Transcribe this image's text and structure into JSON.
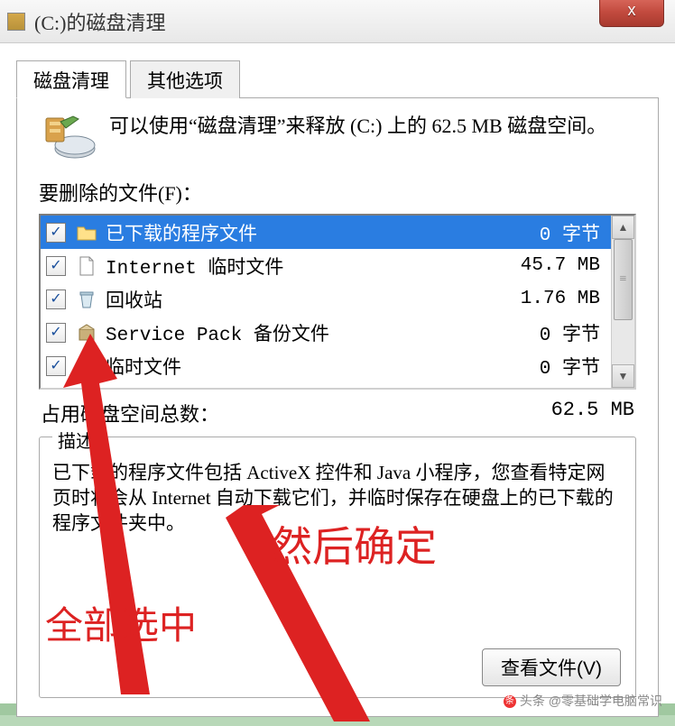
{
  "window": {
    "title": "(C:)的磁盘清理",
    "close_glyph": "x"
  },
  "tabs": {
    "cleanup": "磁盘清理",
    "more_options": "其他选项"
  },
  "intro": "可以使用“磁盘清理”来释放  (C:) 上的 62.5 MB 磁盘空间。",
  "files_label": "要删除的文件(F)：",
  "list": [
    {
      "checked": true,
      "name": "已下载的程序文件",
      "size": "0 字节",
      "selected": true,
      "icon": "folder"
    },
    {
      "checked": true,
      "name": "Internet 临时文件",
      "size": "45.7 MB",
      "selected": false,
      "icon": "file"
    },
    {
      "checked": true,
      "name": "回收站",
      "size": "1.76 MB",
      "selected": false,
      "icon": "recycle"
    },
    {
      "checked": true,
      "name": "Service Pack 备份文件",
      "size": "0 字节",
      "selected": false,
      "icon": "package"
    },
    {
      "checked": true,
      "name": "临时文件",
      "size": "0 字节",
      "selected": false,
      "icon": "folder"
    }
  ],
  "total_label": "占用磁盘空间总数：",
  "total_value": "62.5 MB",
  "description": {
    "legend": "描述",
    "text": "已下载的程序文件包括 ActiveX 控件和 Java 小程序，您查看特定网页时将会从 Internet 自动下载它们，并临时保存在硬盘上的已下载的程序文件夹中。",
    "view_files_btn": "查看文件(V)"
  },
  "annotations": {
    "select_all": "全部选中",
    "then_ok": "然后确定"
  },
  "watermark": "头条 @零基础学电脑常识"
}
